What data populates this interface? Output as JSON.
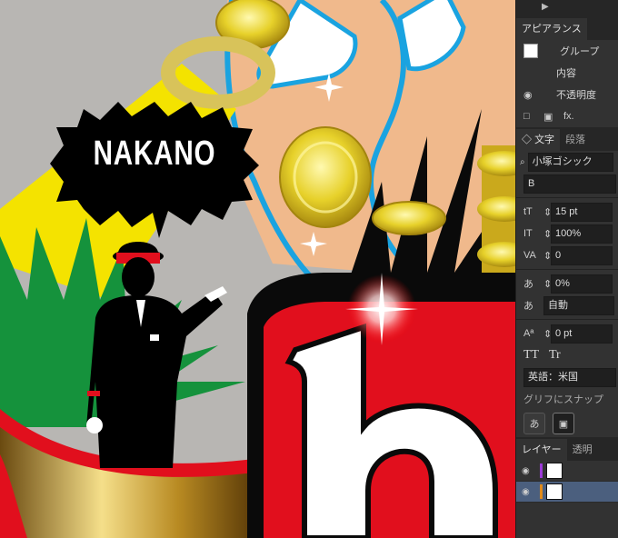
{
  "artwork": {
    "bubble_text": "NAKANO",
    "big_letters": "h",
    "colors": {
      "bg_gray": "#b7b5b2",
      "yellow": "#f3e200",
      "green": "#14913b",
      "skin": "#f0b88a",
      "red": "#e10f1d",
      "black": "#000000",
      "blue": "#1aa3e0",
      "gold": "#d6b91d"
    }
  },
  "panel": {
    "appearance_tab": "アピアランス",
    "group_label": "グループ",
    "contents_label": "内容",
    "opacity_label": "不透明度",
    "fx_label": "fx.",
    "char_tab": "文字",
    "para_tab": "段落",
    "font_family": "小塚ゴシック",
    "font_style": "B",
    "font_size": "15 pt",
    "scale": "100%",
    "kerning": "0",
    "tsume": "0%",
    "aki": "自動",
    "baseline": "0 pt",
    "tt_upper": "TT",
    "tt_small": "Tr",
    "language": "英語：米国",
    "glyph_snap": "グリフにスナップ",
    "layers_tab": "レイヤー",
    "transparency_tab": "透明"
  }
}
